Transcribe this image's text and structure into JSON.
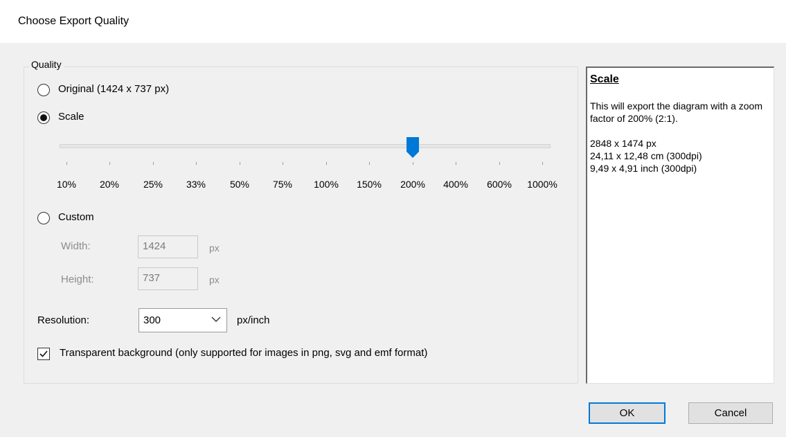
{
  "dialog": {
    "title": "Choose Export Quality"
  },
  "quality": {
    "legend": "Quality",
    "original_label": "Original (1424 x 737 px)",
    "scale_label": "Scale",
    "selected": "scale",
    "scale_options": [
      "10%",
      "20%",
      "25%",
      "33%",
      "50%",
      "75%",
      "100%",
      "150%",
      "200%",
      "400%",
      "600%",
      "1000%"
    ],
    "scale_selected": "200%",
    "custom_label": "Custom",
    "width_label": "Width:",
    "width_value": "1424",
    "width_unit": "px",
    "height_label": "Height:",
    "height_value": "737",
    "height_unit": "px",
    "resolution_label": "Resolution:",
    "resolution_value": "300",
    "resolution_unit": "px/inch",
    "transparent_label": "Transparent background (only supported for images in png, svg and emf format)",
    "transparent_checked": true
  },
  "info": {
    "heading": "Scale",
    "description": "This will export the diagram with a zoom factor of 200% (2:1).",
    "pixels": "2848 x 1474 px",
    "cm": "24,11 x 12,48 cm (300dpi)",
    "inch": "9,49 x 4,91 inch (300dpi)"
  },
  "buttons": {
    "ok": "OK",
    "cancel": "Cancel"
  },
  "colors": {
    "accent": "#0078d7",
    "background": "#f0f0f0"
  },
  "icons": {
    "chevron": "chevron-down-icon",
    "check": "checkmark-icon"
  }
}
